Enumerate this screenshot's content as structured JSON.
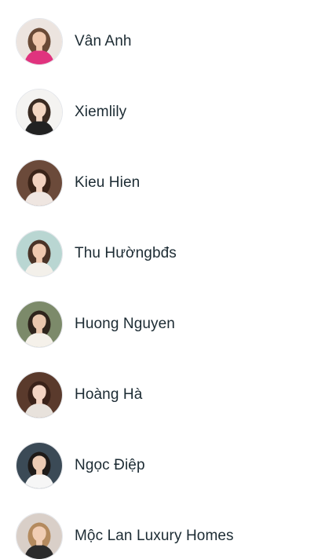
{
  "people": [
    {
      "name": "Vân Anh",
      "avatar_colors": {
        "bg": "#ece4df",
        "hair": "#6a4a36",
        "skin": "#f1c9ae",
        "top": "#e0337e"
      }
    },
    {
      "name": "Xiemlily",
      "avatar_colors": {
        "bg": "#f4f3f1",
        "hair": "#3a2b22",
        "skin": "#f3d7c3",
        "top": "#222222"
      }
    },
    {
      "name": "Kieu Hien",
      "avatar_colors": {
        "bg": "#6b4a3a",
        "hair": "#3b2418",
        "skin": "#f2d2bf",
        "top": "#efe6e1"
      }
    },
    {
      "name": "Thu Hườngbđs",
      "avatar_colors": {
        "bg": "#b9d6d2",
        "hair": "#4a3327",
        "skin": "#efc9b0",
        "top": "#f3f0ea"
      }
    },
    {
      "name": "Huong Nguyen",
      "avatar_colors": {
        "bg": "#7c8a6a",
        "hair": "#2e241c",
        "skin": "#e9c7ae",
        "top": "#f5f1ea"
      }
    },
    {
      "name": "Hoàng Hà",
      "avatar_colors": {
        "bg": "#5a3a2c",
        "hair": "#3a2219",
        "skin": "#f3d4c3",
        "top": "#e8e2dc"
      }
    },
    {
      "name": "Ngọc Điệp",
      "avatar_colors": {
        "bg": "#3b4a56",
        "hair": "#1e1a18",
        "skin": "#eccbb4",
        "top": "#f6f6f6"
      }
    },
    {
      "name": "Mộc Lan Luxury Homes",
      "avatar_colors": {
        "bg": "#d9cfc8",
        "hair": "#b48a5e",
        "skin": "#f1cdb4",
        "top": "#2b2b2b"
      }
    }
  ]
}
